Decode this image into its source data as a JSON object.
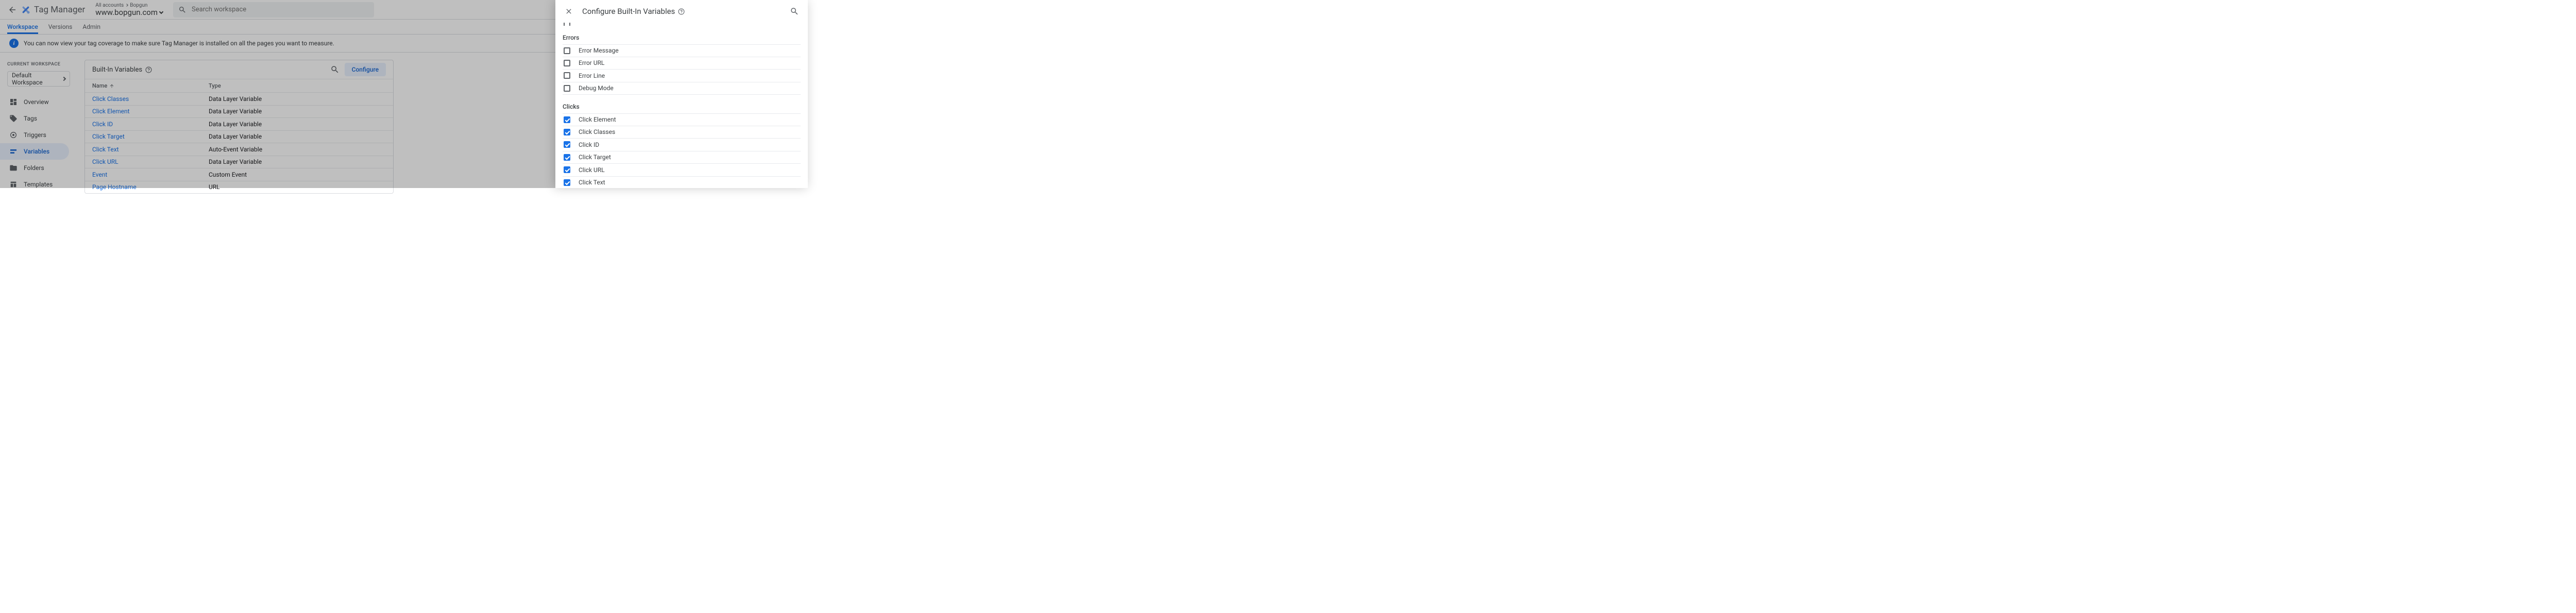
{
  "header": {
    "product_name": "Tag Manager",
    "breadcrumb_root": "All accounts",
    "breadcrumb_container": "Bopgun",
    "workspace_url": "www.bopgun.com",
    "search_placeholder": "Search workspace"
  },
  "tabs": {
    "workspace": "Workspace",
    "versions": "Versions",
    "admin": "Admin"
  },
  "banner": {
    "message": "You can now view your tag coverage to make sure Tag Manager is installed on all the pages you want to measure."
  },
  "sidebar": {
    "heading": "CURRENT WORKSPACE",
    "selector_label": "Default Workspace",
    "items": {
      "overview": "Overview",
      "tags": "Tags",
      "triggers": "Triggers",
      "variables": "Variables",
      "folders": "Folders",
      "templates": "Templates"
    }
  },
  "card": {
    "title": "Built-In Variables",
    "configure_label": "Configure",
    "columns": {
      "name": "Name",
      "type": "Type"
    },
    "rows": [
      {
        "name": "Click Classes",
        "type": "Data Layer Variable"
      },
      {
        "name": "Click Element",
        "type": "Data Layer Variable"
      },
      {
        "name": "Click ID",
        "type": "Data Layer Variable"
      },
      {
        "name": "Click Target",
        "type": "Data Layer Variable"
      },
      {
        "name": "Click Text",
        "type": "Auto-Event Variable"
      },
      {
        "name": "Click URL",
        "type": "Data Layer Variable"
      },
      {
        "name": "Event",
        "type": "Custom Event"
      },
      {
        "name": "Page Hostname",
        "type": "URL"
      }
    ]
  },
  "drawer": {
    "title": "Configure Built-In Variables",
    "sections": {
      "errors": {
        "heading": "Errors",
        "items": [
          {
            "label": "Error Message",
            "checked": false
          },
          {
            "label": "Error URL",
            "checked": false
          },
          {
            "label": "Error Line",
            "checked": false
          },
          {
            "label": "Debug Mode",
            "checked": false
          }
        ]
      },
      "clicks": {
        "heading": "Clicks",
        "items": [
          {
            "label": "Click Element",
            "checked": true
          },
          {
            "label": "Click Classes",
            "checked": true
          },
          {
            "label": "Click ID",
            "checked": true
          },
          {
            "label": "Click Target",
            "checked": true
          },
          {
            "label": "Click URL",
            "checked": true
          },
          {
            "label": "Click Text",
            "checked": true
          }
        ]
      }
    }
  }
}
